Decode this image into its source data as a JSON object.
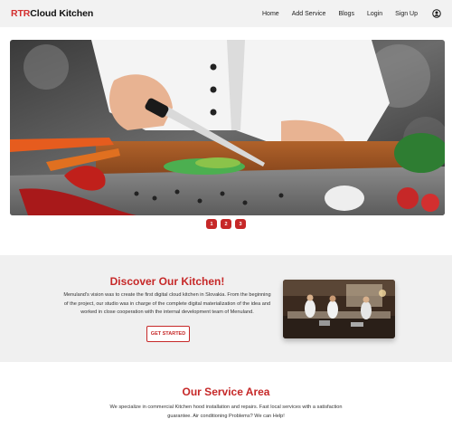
{
  "brand": {
    "part1": "RTR",
    "part2": "Cloud Kitchen"
  },
  "nav": {
    "items": [
      {
        "label": "Home"
      },
      {
        "label": "Add Service"
      },
      {
        "label": "Blogs"
      },
      {
        "label": "Login"
      },
      {
        "label": "Sign Up"
      }
    ],
    "profile_icon": "user-circle-icon"
  },
  "carousel": {
    "pages": [
      "1",
      "2",
      "3"
    ],
    "active": 1
  },
  "discover": {
    "title": "Discover Our Kitchen!",
    "description": "Menuland's vision was to create the first digital cloud kitchen in Slovakia. From the beginning of the project, our studio was in charge of the complete digital materialization of the idea and worked in close cooperation with the internal development team of Menuland.",
    "cta_label": "GET STARTED"
  },
  "service": {
    "title": "Our Service Area",
    "description": "We specialize in commercial Kitchen hood installation and repairs. Fast local services with a satisfaction guarantee. Air conditioning Problems? We can Help!"
  },
  "colors": {
    "accent": "#c62828",
    "nav_bg": "#f2f2f2",
    "section_bg": "#f0f0f0"
  }
}
